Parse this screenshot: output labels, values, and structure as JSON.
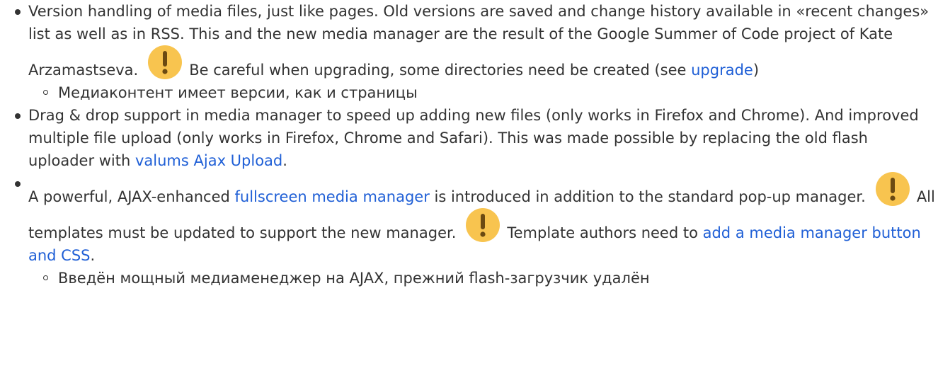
{
  "items": [
    {
      "seg1": "Version handling of media files, just like pages. Old versions are saved and change history available in «recent changes» list as well as in RSS. This and the new media manager are the result of the Google Summer of Code project of Kate Arzamastseva.",
      "seg2": "Be careful when upgrading, some directories need be created (see ",
      "link1": "upgrade",
      "seg3": ")",
      "sub": "Медиаконтент имеет версии, как и страницы"
    },
    {
      "seg1": "Drag & drop support in media manager to speed up adding new files (only works in Firefox and Chrome). And improved multiple file upload (only works in Firefox, Chrome and Safari). This was made possible by replacing the old flash uploader with ",
      "link1": "valums Ajax Upload",
      "seg2": "."
    },
    {
      "seg1": "A powerful, AJAX-enhanced ",
      "link1": "fullscreen media manager",
      "seg2": " is introduced in addition to the standard pop-up manager.",
      "seg3": "All templates must be updated to support the new manager.",
      "seg4": "Template authors need to ",
      "link2": "add a media manager button and CSS",
      "seg5": ".",
      "sub": "Введён мощный медиаменеджер на AJAX, прежний flash-загрузчик удалён"
    }
  ],
  "icons": {
    "warning": "exclamation-icon",
    "warning_color": "#f8c44f",
    "warning_mark_color": "#6b4a12"
  },
  "colors": {
    "text": "#333333",
    "link": "#1f5fd6"
  }
}
